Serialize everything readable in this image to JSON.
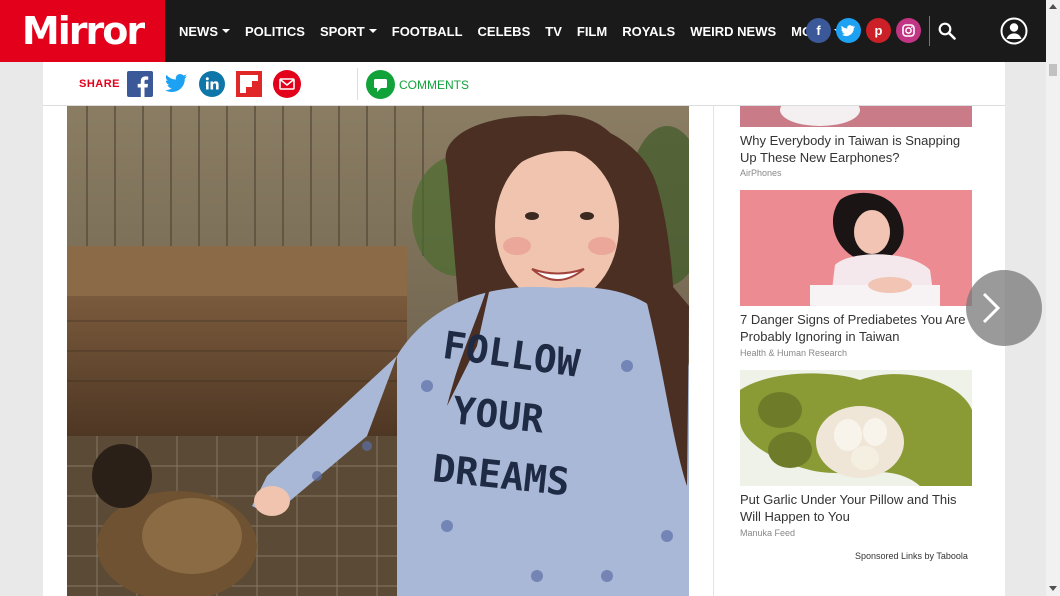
{
  "header": {
    "logo": "Mirror",
    "nav": [
      {
        "label": "NEWS",
        "dropdown": true
      },
      {
        "label": "POLITICS",
        "dropdown": false
      },
      {
        "label": "SPORT",
        "dropdown": true
      },
      {
        "label": "FOOTBALL",
        "dropdown": false
      },
      {
        "label": "CELEBS",
        "dropdown": false
      },
      {
        "label": "TV",
        "dropdown": false
      },
      {
        "label": "FILM",
        "dropdown": false
      },
      {
        "label": "ROYALS",
        "dropdown": false
      },
      {
        "label": "WEIRD NEWS",
        "dropdown": false
      },
      {
        "label": "MORE",
        "dropdown": true
      }
    ],
    "social": [
      {
        "icon": "facebook-icon",
        "glyph": "f",
        "color": "#3b5998"
      },
      {
        "icon": "twitter-icon",
        "glyph": "t",
        "color": "#1da1f2"
      },
      {
        "icon": "pinterest-icon",
        "glyph": "p",
        "color": "#cb2027"
      },
      {
        "icon": "instagram-icon",
        "glyph": "◎",
        "color": "#c13584"
      }
    ]
  },
  "sharebar": {
    "share_label": "SHARE",
    "comments_label": "COMMENTS"
  },
  "sidebar": {
    "ads": [
      {
        "title": "Why Everybody in Taiwan is Snapping Up These New Earphones?",
        "source": "AirPhones"
      },
      {
        "title": "7 Danger Signs of Prediabetes You Are Probably Ignoring in Taiwan",
        "source": "Health & Human Research"
      },
      {
        "title": "Put Garlic Under Your Pillow and This Will Happen to You",
        "source": "Manuka Feed"
      }
    ],
    "sponsored": "Sponsored Links by Taboola"
  },
  "photo": {
    "shirt_text": [
      "FOLLOW",
      "YOUR",
      "DREAMS"
    ]
  },
  "colors": {
    "brand": "#e2001a",
    "topbar": "#1a1a1a",
    "comments": "#11a33a"
  }
}
